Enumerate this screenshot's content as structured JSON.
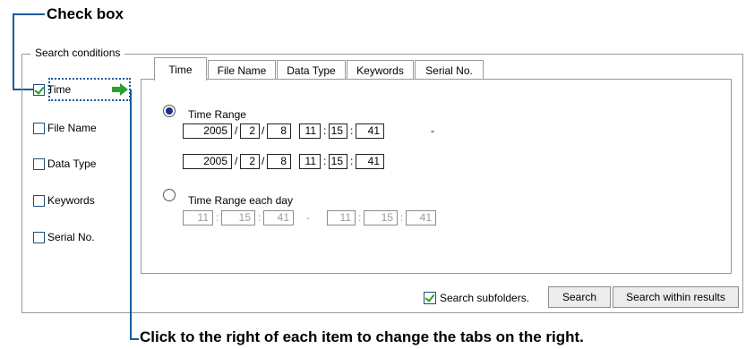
{
  "callouts": {
    "top": "Check box",
    "bottom": "Click to the right of each item to change the tabs on the right."
  },
  "group_title": "Search conditions",
  "items": [
    {
      "label": "Time",
      "checked": true
    },
    {
      "label": "File Name",
      "checked": false
    },
    {
      "label": "Data Type",
      "checked": false
    },
    {
      "label": "Keywords",
      "checked": false
    },
    {
      "label": "Serial No.",
      "checked": false
    }
  ],
  "arrow_icon": "green-right-arrow-icon",
  "tabs": [
    "Time",
    "File Name",
    "Data Type",
    "Keywords",
    "Serial No."
  ],
  "active_tab": "Time",
  "time_range": {
    "label": "Time Range",
    "selected": true,
    "from": {
      "year": "2005",
      "month": "2",
      "day": "8",
      "hour": "11",
      "minute": "15",
      "second": "41"
    },
    "to": {
      "year": "2005",
      "month": "2",
      "day": "8",
      "hour": "11",
      "minute": "15",
      "second": "41"
    },
    "date_sep": "/",
    "time_sep": ":",
    "range_sep": "-"
  },
  "time_range_each_day": {
    "label": "Time Range each day",
    "selected": false,
    "from": {
      "hour": "11",
      "minute": "15",
      "second": "41"
    },
    "to": {
      "hour": "11",
      "minute": "15",
      "second": "41"
    },
    "range_sep": "-"
  },
  "search_subfolders": {
    "label": "Search subfolders.",
    "checked": true
  },
  "buttons": {
    "search": "Search",
    "search_within": "Search within results"
  },
  "colors": {
    "callout_line": "#1a5a9c",
    "check": "#21a121",
    "radio_dot": "#1c2f8c",
    "arrow": "#2ea12e"
  }
}
